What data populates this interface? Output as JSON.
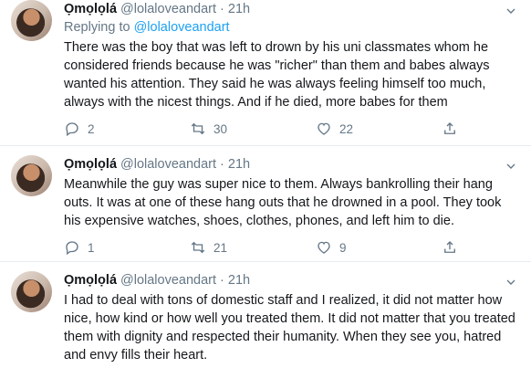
{
  "tweets": [
    {
      "name": "Ọmọlọlá",
      "handle": "@lolaloveandart",
      "separator": "·",
      "time": "21h",
      "reply_prefix": "Replying to",
      "reply_to": "@lolaloveandart",
      "text": "There was the boy that was left to drown by his uni classmates whom he considered friends because he was \"richer\" than them and babes always wanted his attention. They said he was always feeling himself too much, always with the nicest things. And if he died, more babes for them",
      "replies": "2",
      "retweets": "30",
      "likes": "22"
    },
    {
      "name": "Ọmọlọlá",
      "handle": "@lolaloveandart",
      "separator": "·",
      "time": "21h",
      "text": "Meanwhile the guy was super nice to them. Always bankrolling their hang outs. It was at one of these hang outs that he drowned in a pool. They took his expensive watches, shoes, clothes, phones, and left him to die.",
      "replies": "1",
      "retweets": "21",
      "likes": "9"
    },
    {
      "name": "Ọmọlọlá",
      "handle": "@lolaloveandart",
      "separator": "·",
      "time": "21h",
      "text": "I had to deal with tons of domestic staff and I realized, it did not matter how nice, how kind or how well you treated them. It did not matter that you treated them with dignity and respected their humanity. When they see you, hatred and envy fills their heart."
    }
  ],
  "colors": {
    "text": "#14171a",
    "secondary": "#657786",
    "link": "#1da1f2",
    "divider": "#e6ecf0"
  },
  "icons": [
    "reply-icon",
    "retweet-icon",
    "like-icon",
    "share-icon",
    "chevron-down-icon"
  ]
}
